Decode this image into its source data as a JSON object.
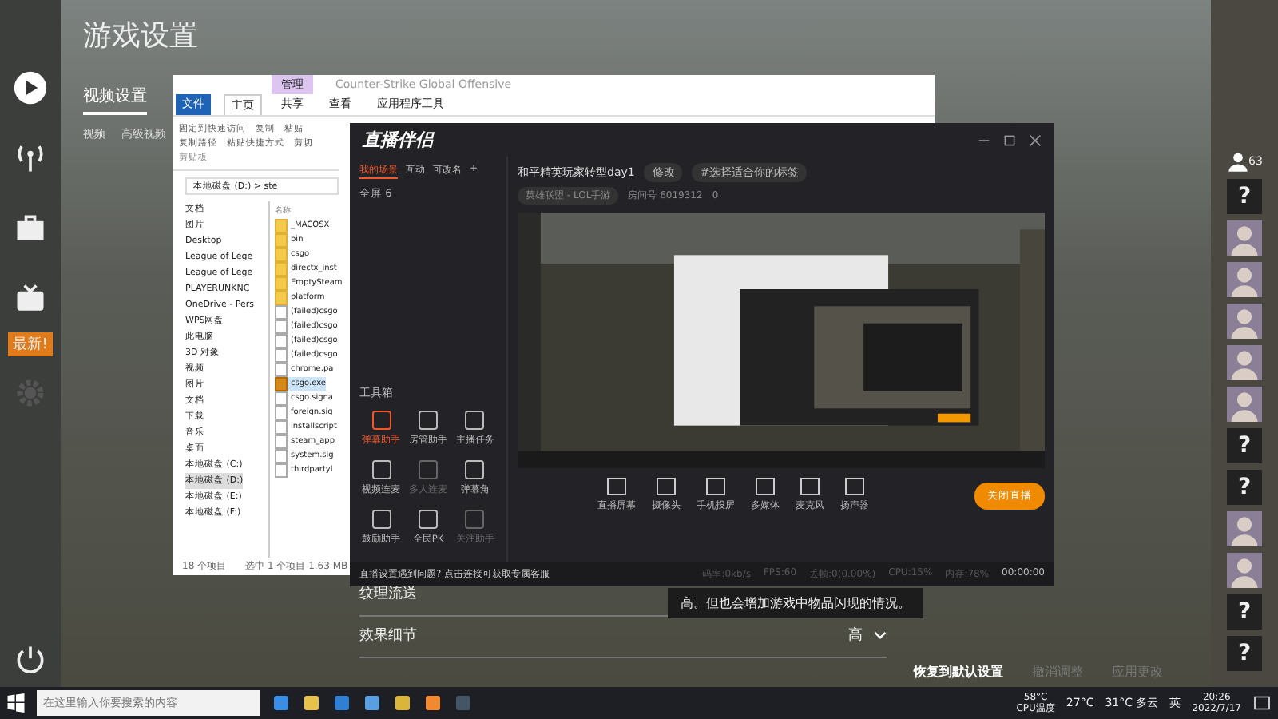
{
  "game": {
    "title": "游戏设置",
    "tabs": [
      {
        "label": "视频设置",
        "selected": true
      }
    ],
    "subtabs": [
      {
        "label": "视频",
        "selected": false
      },
      {
        "label": "高级视频",
        "selected": false
      }
    ],
    "sidebar_badge": "最新!",
    "rows": [
      {
        "label": "纹理流送"
      },
      {
        "label": "效果细节",
        "value": "高"
      }
    ],
    "tooltip": "高。但也会增加游戏中物品闪现的情况。",
    "footer": [
      {
        "label": "恢复到默认设置",
        "disabled": false
      },
      {
        "label": "撤消调整",
        "disabled": true
      },
      {
        "label": "应用更改",
        "disabled": true
      }
    ],
    "friends_count": "63",
    "friends": [
      {
        "kind": "unknown",
        "label": "?"
      },
      {
        "kind": "avatar"
      },
      {
        "kind": "avatar"
      },
      {
        "kind": "avatar"
      },
      {
        "kind": "avatar"
      },
      {
        "kind": "avatar"
      },
      {
        "kind": "unknown",
        "label": "?"
      },
      {
        "kind": "unknown",
        "label": "?"
      },
      {
        "kind": "avatar"
      },
      {
        "kind": "avatar"
      },
      {
        "kind": "unknown",
        "label": "?"
      },
      {
        "kind": "unknown",
        "label": "?"
      }
    ]
  },
  "explorer": {
    "title": "Counter-Strike Global Offensive",
    "context_tab": "管理",
    "tabs": [
      {
        "label": "文件",
        "selected": false,
        "kind": "file"
      },
      {
        "label": "主页",
        "selected": true,
        "kind": "tab"
      },
      {
        "label": "共享",
        "selected": false,
        "kind": "tab"
      },
      {
        "label": "查看",
        "selected": false,
        "kind": "tab"
      },
      {
        "label": "应用程序工具",
        "selected": false,
        "kind": "tab"
      }
    ],
    "ribbon": [
      "固定到快速访问",
      "复制",
      "粘贴",
      "复制路径",
      "粘贴快捷方式",
      "剪切"
    ],
    "ribbon_group": "剪贴板",
    "address": "本地磁盘 (D:)  >  ste",
    "nav": [
      {
        "label": "文档"
      },
      {
        "label": "图片"
      },
      {
        "label": "Desktop"
      },
      {
        "label": "League of Lege"
      },
      {
        "label": "League of Lege"
      },
      {
        "label": "PLAYERUNKNC"
      },
      {
        "label": "OneDrive - Pers"
      },
      {
        "label": "WPS网盘"
      },
      {
        "label": "此电脑"
      },
      {
        "label": "3D 对象"
      },
      {
        "label": "视频"
      },
      {
        "label": "图片"
      },
      {
        "label": "文档"
      },
      {
        "label": "下载"
      },
      {
        "label": "音乐"
      },
      {
        "label": "桌面"
      },
      {
        "label": "本地磁盘 (C:)"
      },
      {
        "label": "本地磁盘 (D:)",
        "selected": true
      },
      {
        "label": "本地磁盘 (E:)"
      },
      {
        "label": "本地磁盘 (F:)"
      }
    ],
    "column": "名称",
    "files": [
      {
        "name": "_MACOSX",
        "kind": "folder",
        "selected": false
      },
      {
        "name": "bin",
        "kind": "folder",
        "selected": false
      },
      {
        "name": "csgo",
        "kind": "folder",
        "selected": false
      },
      {
        "name": "directx_inst",
        "kind": "folder",
        "selected": false
      },
      {
        "name": "EmptySteam",
        "kind": "folder",
        "selected": false
      },
      {
        "name": "platform",
        "kind": "folder",
        "selected": false
      },
      {
        "name": "(failed)csgo",
        "kind": "file",
        "selected": false
      },
      {
        "name": "(failed)csgo",
        "kind": "file",
        "selected": false
      },
      {
        "name": "(failed)csgo",
        "kind": "file",
        "selected": false
      },
      {
        "name": "(failed)csgo",
        "kind": "file",
        "selected": false
      },
      {
        "name": "chrome.pa",
        "kind": "file",
        "selected": false
      },
      {
        "name": "csgo.exe",
        "kind": "exe",
        "selected": true
      },
      {
        "name": "csgo.signa",
        "kind": "file",
        "selected": false
      },
      {
        "name": "foreign.sig",
        "kind": "file",
        "selected": false
      },
      {
        "name": "installscript",
        "kind": "file",
        "selected": false
      },
      {
        "name": "steam_app",
        "kind": "file",
        "selected": false
      },
      {
        "name": "system.sig",
        "kind": "file",
        "selected": false
      },
      {
        "name": "thirdpartyl",
        "kind": "file",
        "selected": false
      }
    ],
    "status": [
      "18 个项目",
      "选中 1 个项目  1.63 MB"
    ]
  },
  "stream": {
    "app": "直播伴侣",
    "tabs": [
      {
        "label": "我的场景",
        "selected": true
      },
      {
        "label": "互动",
        "selected": false
      },
      {
        "label": "可改名",
        "selected": false
      }
    ],
    "add": "+",
    "scene": "全屏 6",
    "room_title": "和平精英玩家转型day1",
    "edit": "修改",
    "tag": "#选择适合你的标签",
    "category": "英雄联盟 - LOL手游",
    "room": "房间号  6019312",
    "heat": "0",
    "toolbox": "工具箱",
    "tools": [
      {
        "label": "弹幕助手",
        "disabled": false,
        "active": true
      },
      {
        "label": "房管助手",
        "disabled": false,
        "active": false
      },
      {
        "label": "主播任务",
        "disabled": false,
        "active": false
      },
      {
        "label": "视频连麦",
        "disabled": false,
        "active": false
      },
      {
        "label": "多人连麦",
        "disabled": true,
        "active": false
      },
      {
        "label": "弹幕角",
        "disabled": false,
        "active": false
      },
      {
        "label": "鼓励助手",
        "disabled": false,
        "active": false
      },
      {
        "label": "全民PK",
        "disabled": false,
        "active": false
      },
      {
        "label": "关注助手",
        "disabled": true,
        "active": false
      }
    ],
    "controls": [
      "直播屏幕",
      "摄像头",
      "手机投屏",
      "多媒体",
      "麦克风",
      "扬声器"
    ],
    "go_live": "关闭直播",
    "help": "直播设置遇到问题? 点击连接可获取专属客服",
    "stats": [
      "码率:0kb/s",
      "FPS:60",
      "丢帧:0(0.00%)",
      "CPU:15%",
      "内存:78%"
    ],
    "timer": "00:00:00"
  },
  "taskbar": {
    "search": {
      "placeholder": "在这里输入你要搜索的内容"
    },
    "cpu_temp": "58°C",
    "cpu_label": "CPU温度",
    "temp": "27°C",
    "weather": "31°C 多云",
    "ime": "英",
    "time": "20:26",
    "date": "2022/7/17"
  }
}
